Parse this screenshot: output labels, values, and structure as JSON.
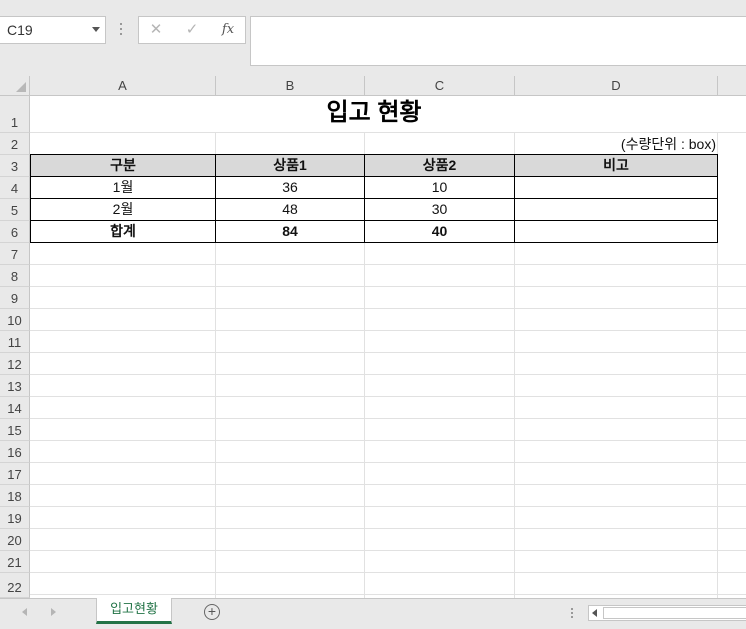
{
  "name_box": {
    "value": "C19"
  },
  "formula_bar": {
    "cancel_glyph": "✕",
    "enter_glyph": "✓",
    "fx_label": "fx",
    "content": ""
  },
  "columns": [
    "A",
    "B",
    "C",
    "D"
  ],
  "rows": [
    "1",
    "2",
    "3",
    "4",
    "5",
    "6",
    "7",
    "8",
    "9",
    "10",
    "11",
    "12",
    "13",
    "14",
    "15",
    "16",
    "17",
    "18",
    "19",
    "20",
    "21",
    "22"
  ],
  "sheet": {
    "title": "입고 현황",
    "unit_note": "(수량단위 : box)",
    "table": {
      "headers": [
        "구분",
        "상품1",
        "상품2",
        "비고"
      ],
      "rows": [
        [
          "1월",
          "36",
          "10",
          ""
        ],
        [
          "2월",
          "48",
          "30",
          ""
        ],
        [
          "합계",
          "84",
          "40",
          ""
        ]
      ]
    }
  },
  "tabs": {
    "active_sheet": "입고현황",
    "add_glyph": "+"
  },
  "colors": {
    "accent": "#217346",
    "header_fill": "#d9d9d9"
  }
}
